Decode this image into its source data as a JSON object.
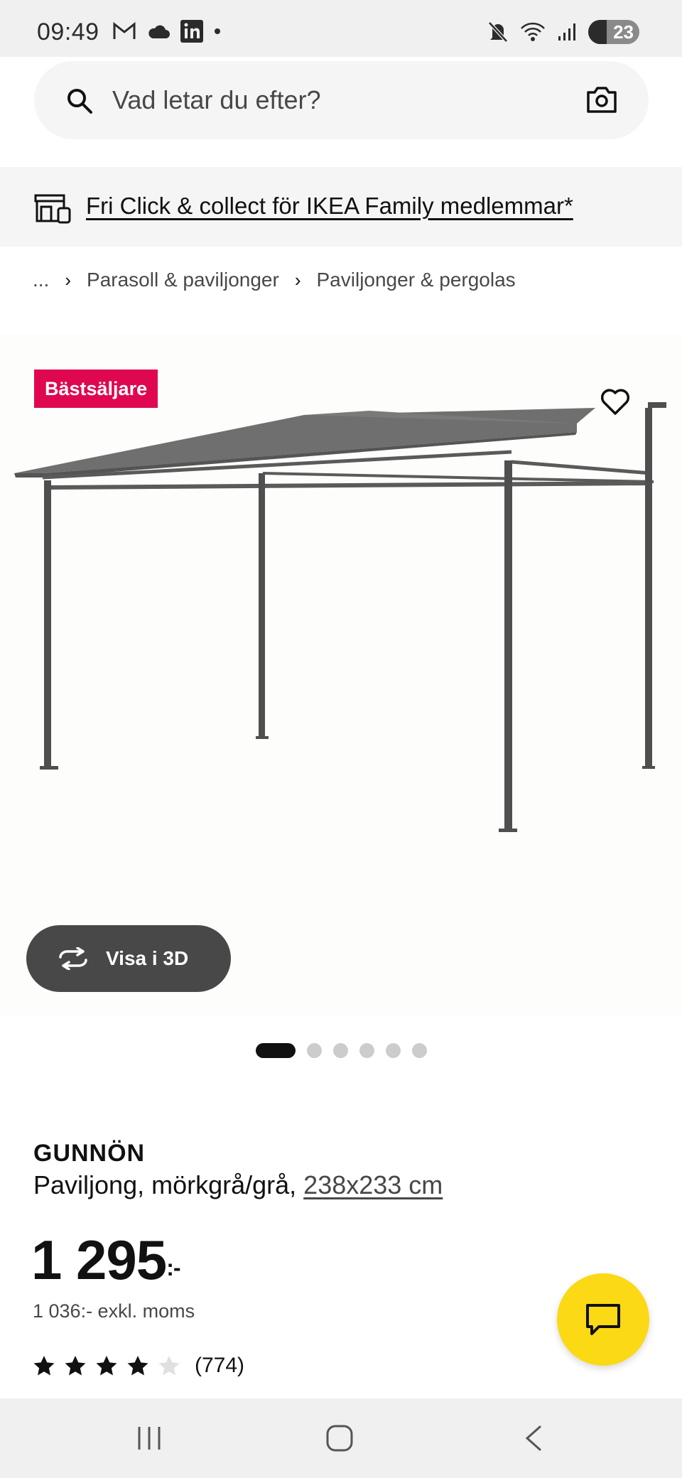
{
  "status_bar": {
    "time": "09:49",
    "left_icons": [
      "gmail-icon",
      "cloud-icon",
      "linkedin-icon",
      "dot-icon"
    ],
    "right_icons": [
      "mute-icon",
      "wifi-icon",
      "signal-icon",
      "battery-icon"
    ],
    "battery": "23"
  },
  "search": {
    "placeholder": "Vad letar du efter?"
  },
  "promo": {
    "text": "Fri Click & collect för IKEA Family medlemmar*"
  },
  "breadcrumb": {
    "items": [
      "...",
      "Parasoll & paviljonger",
      "Paviljonger & pergolas"
    ]
  },
  "product": {
    "badge": "Bästsäljare",
    "view_3d_label": "Visa i 3D",
    "image_count": 6,
    "active_image": 1,
    "name": "GUNNÖN",
    "description": "Paviljong, mörkgrå/grå, ",
    "size": "238x233 cm",
    "price": "1 295",
    "price_suffix": ":-",
    "price_ex_vat": "1 036:- exkl. moms",
    "rating": 4,
    "rating_max": 5,
    "review_count": "(774)"
  },
  "colors": {
    "badge": "#e00751",
    "chat_button": "#fbd914",
    "view_3d_button": "#484848"
  }
}
